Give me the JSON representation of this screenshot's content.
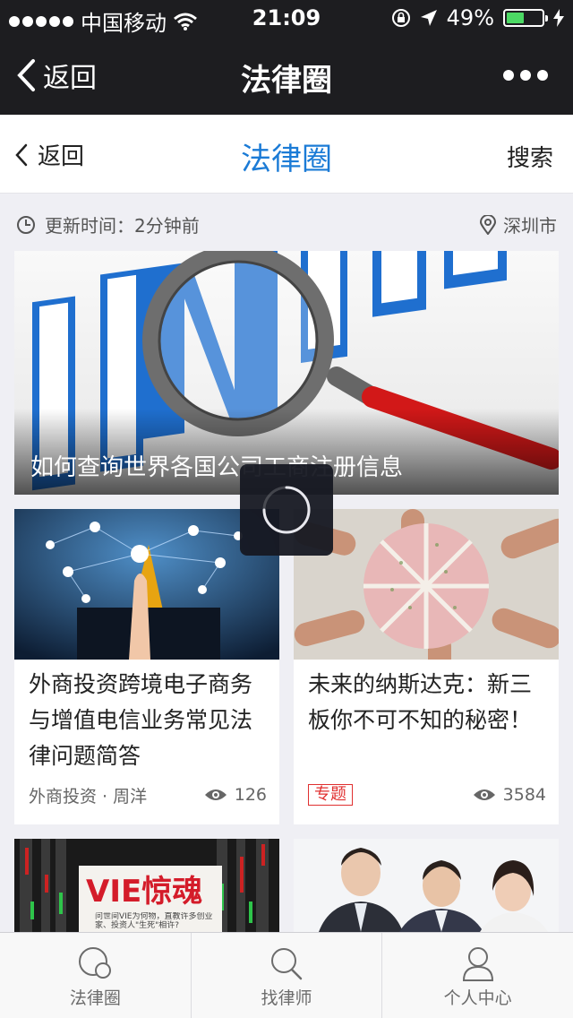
{
  "status_bar": {
    "carrier": "中国移动",
    "time": "21:09",
    "battery": "49%",
    "battery_level": 0.49,
    "signal_icon": "signal-dots-icon",
    "wifi_icon": "wifi-icon"
  },
  "wechat_nav": {
    "back_label": "返回",
    "title": "法律圈"
  },
  "page_header": {
    "back_label": "返回",
    "title": "法律圈",
    "search_label": "搜索",
    "title_color": "#1b7bd6"
  },
  "info": {
    "updated": "更新时间：2分钟前",
    "city": "深圳市"
  },
  "hero": {
    "caption": "如何查询世界各国公司工商注册信息"
  },
  "cards": [
    {
      "title": "外商投资跨境电子商务与增值电信业务常见法律问题简答",
      "source": "外商投资 · 周洋",
      "views": "126"
    },
    {
      "title": "未来的纳斯达克：新三板你不可不知的秘密！",
      "tag": "专题",
      "views": "3584"
    },
    {
      "image_text": "VIE惊魂",
      "image_subtext": "问世间VIE为何物，直教许多创业家、投资人\"生死\"相许?"
    },
    {}
  ],
  "tabbar": {
    "items": [
      {
        "label": "法律圈",
        "icon": "circles-icon"
      },
      {
        "label": "找律师",
        "icon": "search-icon"
      },
      {
        "label": "个人中心",
        "icon": "user-icon"
      }
    ]
  },
  "colors": {
    "accent": "#1b7bd6",
    "tag_red": "#e03030",
    "battery_green": "#4cd964",
    "nav_bg": "#1d1d20"
  }
}
